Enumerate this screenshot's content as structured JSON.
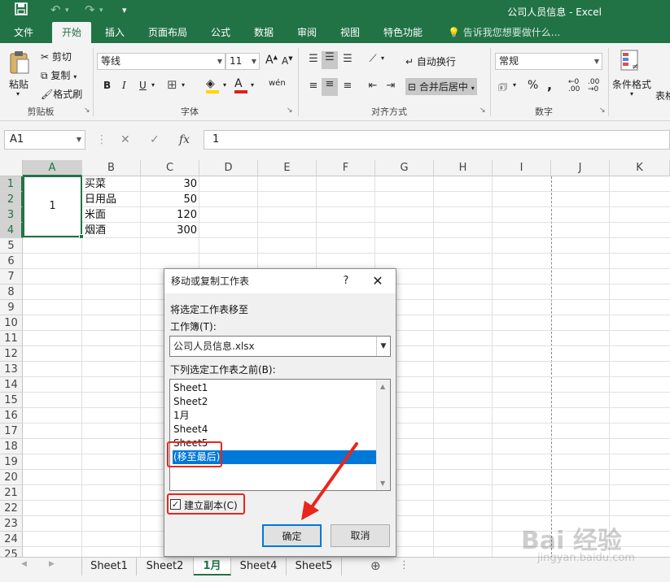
{
  "window": {
    "title": "公司人员信息 - Excel"
  },
  "ribbon_tabs": [
    "文件",
    "开始",
    "插入",
    "页面布局",
    "公式",
    "数据",
    "审阅",
    "视图",
    "特色功能"
  ],
  "active_tab": "开始",
  "tell_me": "告诉我您想要做什么...",
  "clipboard": {
    "paste": "粘贴",
    "cut": "剪切",
    "copy": "复制",
    "format_painter": "格式刷",
    "group": "剪贴板"
  },
  "font": {
    "name": "等线",
    "size": "11",
    "group": "字体",
    "bold": "B",
    "italic": "I",
    "underline": "U",
    "wen": "wén"
  },
  "alignment": {
    "wrap": "自动换行",
    "merge": "合并后居中",
    "group": "对齐方式"
  },
  "number": {
    "format": "常规",
    "percent": "%",
    "comma": ",",
    "group": "数字"
  },
  "styles": {
    "conditional": "条件格式",
    "table": "表格"
  },
  "formula_bar": {
    "name_box": "A1",
    "fx": "fx",
    "value": "1"
  },
  "columns": [
    "A",
    "B",
    "C",
    "D",
    "E",
    "F",
    "G",
    "H",
    "I",
    "J",
    "K"
  ],
  "rows": [
    "1",
    "2",
    "3",
    "4",
    "5",
    "6",
    "7",
    "8",
    "9",
    "10",
    "11",
    "12",
    "13",
    "14",
    "15",
    "16",
    "17",
    "18",
    "19",
    "20",
    "21",
    "22",
    "23",
    "24",
    "25"
  ],
  "cells": {
    "a_merged": "1",
    "b": [
      "买菜",
      "日用品",
      "米面",
      "烟酒"
    ],
    "c": [
      "30",
      "50",
      "120",
      "300"
    ]
  },
  "sheets": [
    "Sheet1",
    "Sheet2",
    "1月",
    "Sheet4",
    "Sheet5"
  ],
  "active_sheet": "1月",
  "dialog": {
    "title": "移动或复制工作表",
    "help": "?",
    "move_to_label": "将选定工作表移至",
    "workbook_label": "工作簿(T):",
    "workbook_value": "公司人员信息.xlsx",
    "before_label": "下列选定工作表之前(B):",
    "list": [
      "Sheet1",
      "Sheet2",
      "1月",
      "Sheet4",
      "Sheet5",
      "(移至最后)"
    ],
    "selected_item": "(移至最后)",
    "create_copy_label": "建立副本(C)",
    "create_copy_checked": true,
    "ok": "确定",
    "cancel": "取消"
  },
  "watermark": {
    "brand": "Bai 经验",
    "url": "jingyan.baidu.com"
  },
  "colors": {
    "excel_green": "#217346",
    "selection_blue": "#0078d7",
    "annotation_red": "#e8261b"
  }
}
